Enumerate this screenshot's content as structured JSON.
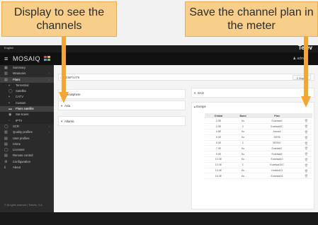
{
  "annotations": {
    "left": "Display to see the channels",
    "right": "Save the channel plan in the meter"
  },
  "app": {
    "language": "English",
    "brand": "Telev",
    "logo": "MOSAIQ",
    "user": "admin"
  },
  "sidebar": {
    "items": [
      {
        "icon": "▦",
        "label": "Summary",
        "type": "top"
      },
      {
        "icon": "▥",
        "label": "Measures",
        "type": "top",
        "chevron": "‹"
      },
      {
        "icon": "▤",
        "label": "Plans",
        "type": "top-active",
        "chevron": "‹"
      },
      {
        "icon": "◐",
        "label": "Terrestrial",
        "type": "sub"
      },
      {
        "icon": "◯",
        "label": "Satellite",
        "type": "sub"
      },
      {
        "icon": "▪",
        "label": "CATV",
        "type": "sub"
      },
      {
        "icon": "▪",
        "label": "Custom",
        "type": "sub"
      },
      {
        "icon": "▬",
        "label": "Plans satellite",
        "type": "sub-active"
      },
      {
        "icon": "◉",
        "label": "Sat scans",
        "type": "sub"
      },
      {
        "icon": "▫",
        "label": "IPTV",
        "type": "sub"
      },
      {
        "icon": "◯",
        "label": "SCR",
        "type": "top",
        "chevron": "‹"
      },
      {
        "icon": "▥",
        "label": "Quality profiles",
        "type": "top",
        "chevron": "‹"
      },
      {
        "icon": "▤",
        "label": "User profiles",
        "type": "top"
      },
      {
        "icon": "▤",
        "label": "Clone",
        "type": "top"
      },
      {
        "icon": "◯",
        "label": "Licenses",
        "type": "top"
      },
      {
        "icon": "▤",
        "label": "Remote control",
        "type": "top"
      },
      {
        "icon": "⚙",
        "label": "Configuration",
        "type": "top"
      },
      {
        "icon": "ℹ",
        "label": "About",
        "type": "top"
      }
    ],
    "footer": "© All rights reserved | Televés, S.A."
  },
  "content": {
    "plan_name": "EMPSAT9",
    "export_label": "Export",
    "left_cards": [
      {
        "label": "Hemisphere",
        "chevron": "▾"
      },
      {
        "label": "Asia",
        "chevron": "▾"
      },
      {
        "label": "Atlantic",
        "chevron": "▾"
      }
    ],
    "sat_card": {
      "label": "SAO",
      "chevron": "▾"
    },
    "europe": {
      "label": "Europe",
      "chevron": "▴"
    },
    "table": {
      "headers": [
        "Orbital",
        "Band",
        "Plan"
      ],
      "rows": [
        [
          "3.0E",
          "Ku",
          "Eutelsat3"
        ],
        [
          "3.0E",
          "C",
          "Eutelsat3C"
        ],
        [
          "4.8E",
          "Ku",
          "Amos4"
        ],
        [
          "5.0E",
          "Ku",
          "SES5"
        ],
        [
          "5.0E",
          "C",
          "SES5C"
        ],
        [
          "7.0E",
          "Ku",
          "Eutelsat7"
        ],
        [
          "9.0E",
          "Ku",
          "Eutelsat9"
        ],
        [
          "10.0E",
          "Ku",
          "Eutelsat10"
        ],
        [
          "10.0E",
          "C",
          "Eutelsat10C"
        ],
        [
          "13.0E",
          "Ku",
          "Hotbird13"
        ],
        [
          "16.0E",
          "Ku",
          "Eutelsat16"
        ]
      ],
      "trash_icon": "🗑"
    }
  }
}
